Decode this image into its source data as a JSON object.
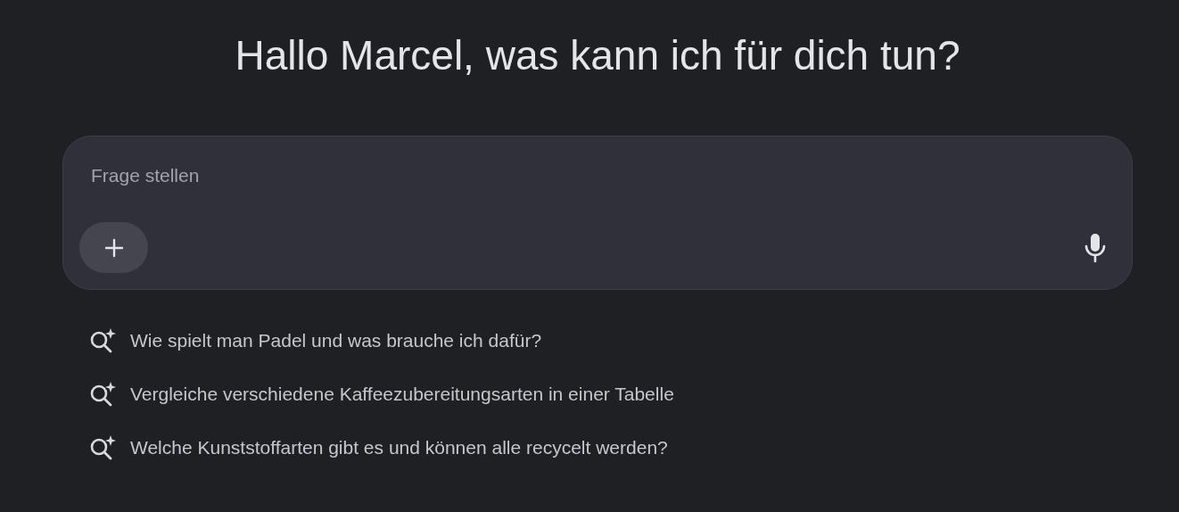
{
  "greeting": "Hallo Marcel, was kann ich für dich tun?",
  "prompt": {
    "placeholder": "Frage stellen"
  },
  "suggestions": [
    {
      "text": "Wie spielt man Padel und was brauche ich dafür?"
    },
    {
      "text": "Vergleiche verschiedene Kaffeezubereitungsarten in einer Tabelle"
    },
    {
      "text": "Welche Kunststoffarten gibt es und können alle recycelt werden?"
    }
  ]
}
